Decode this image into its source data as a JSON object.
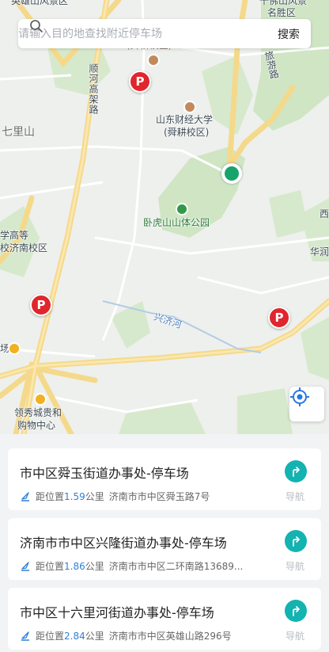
{
  "search": {
    "placeholder": "请输入目的地查找附近停车场",
    "button_label": "搜索"
  },
  "map": {
    "labels": {
      "yingxiong_top": "英雄山风景区",
      "qianfo_top": "千佛山风景",
      "qianfo_top2": "名胜区",
      "shunhe": "顺河高架路",
      "lvyou": "旅游路",
      "shunyu": "(舜耕校区)",
      "caijing": "山东财经大学",
      "caijing2": "(舜耕校区)",
      "qili": "七里山",
      "wohushan": "卧虎山山体公园",
      "gaodeng": "学高等",
      "jinan_campus": "校济南校区",
      "xi": "西",
      "hua": "华润",
      "xingji": "兴济河",
      "lingxiu": "领秀城贵和",
      "lingxiu2": "购物中心",
      "chang": "场"
    },
    "parking_marker_label": "P"
  },
  "results": [
    {
      "title": "市中区舜玉街道办事处-停车场",
      "distance_prefix": "距位置",
      "distance": "1.59",
      "distance_unit": "公里",
      "address": "济南市市中区舜玉路7号",
      "nav_label": "导航"
    },
    {
      "title": "济南市市中区兴隆街道办事处-停车场",
      "distance_prefix": "距位置",
      "distance": "1.86",
      "distance_unit": "公里",
      "address": "济南市市中区二环南路13689...",
      "nav_label": "导航"
    },
    {
      "title": "市中区十六里河街道办事处-停车场",
      "distance_prefix": "距位置",
      "distance": "2.84",
      "distance_unit": "公里",
      "address": "济南市市中区英雄山路296号",
      "nav_label": "导航"
    }
  ],
  "colors": {
    "parking_marker": "#e0262c",
    "current_location": "#17a46b",
    "nav_button": "#12b3b1",
    "distance": "#2f7fd8"
  }
}
